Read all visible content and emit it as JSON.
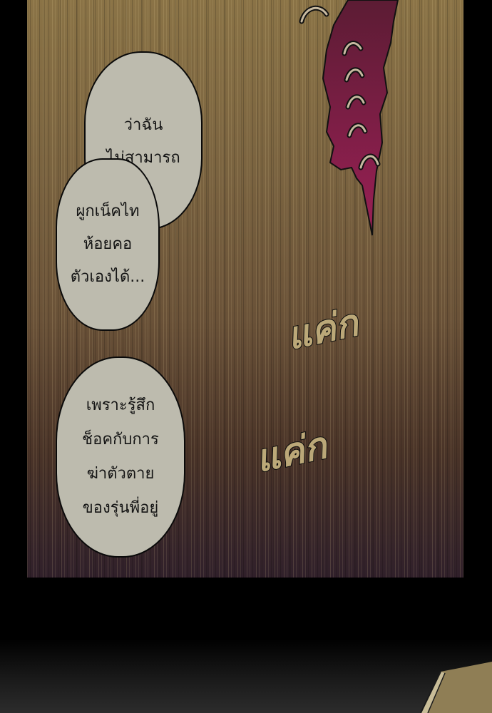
{
  "panel": {
    "bubbles": [
      {
        "lines": [
          "ว่าฉัน",
          "ไม่สามารถ"
        ]
      },
      {
        "lines": [
          "ผูกเน็คไท",
          "ห้อยคอ",
          "ตัวเองได้..."
        ]
      },
      {
        "lines": [
          "เพราะรู้สึก",
          "ช็อคกับการ",
          "ฆ่าตัวตาย",
          "ของรุ่นพี่อยู่"
        ]
      }
    ],
    "sfx": [
      "แค่ก",
      "แค่ก"
    ]
  },
  "colors": {
    "bubble_fill": "#bdbbae",
    "bubble_outline": "#0a0a0a",
    "background_top": "#8a7346",
    "background_bottom": "#30202a",
    "torn_shape": "#8a1f4a",
    "sfx_fill": "#bba878"
  }
}
